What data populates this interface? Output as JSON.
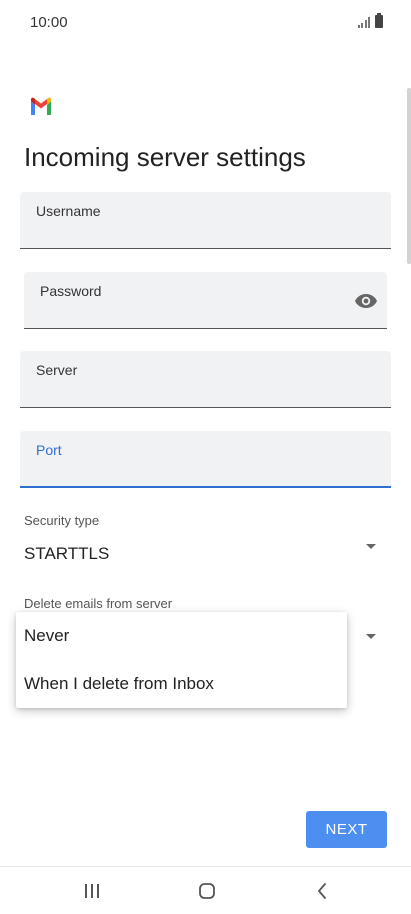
{
  "status_bar": {
    "time": "10:00"
  },
  "app": {
    "logo": "gmail-logo",
    "title": "Incoming server settings"
  },
  "form": {
    "username": {
      "label": "Username",
      "value": ""
    },
    "password": {
      "label": "Password",
      "value": "",
      "toggle_icon": "eye-icon"
    },
    "server": {
      "label": "Server",
      "value": ""
    },
    "port": {
      "label": "Port",
      "value": "",
      "focused": true
    },
    "security_type": {
      "label": "Security type",
      "value": "STARTTLS"
    },
    "delete_emails": {
      "label": "Delete emails from server"
    }
  },
  "popup_menu": {
    "options": [
      "Never",
      "When I delete from Inbox"
    ]
  },
  "actions": {
    "next_label": "NEXT"
  },
  "nav_bar": {
    "recents_icon": "recents-icon",
    "home_icon": "home-icon",
    "back_icon": "back-icon"
  },
  "colors": {
    "accent": "#4d8ff0",
    "focus": "#2f6fd0",
    "field_bg": "#f1f2f4",
    "gmail_red": "#ea4335",
    "gmail_blue": "#4285f4",
    "gmail_green": "#34a853",
    "gmail_yellow": "#fbbc04"
  }
}
